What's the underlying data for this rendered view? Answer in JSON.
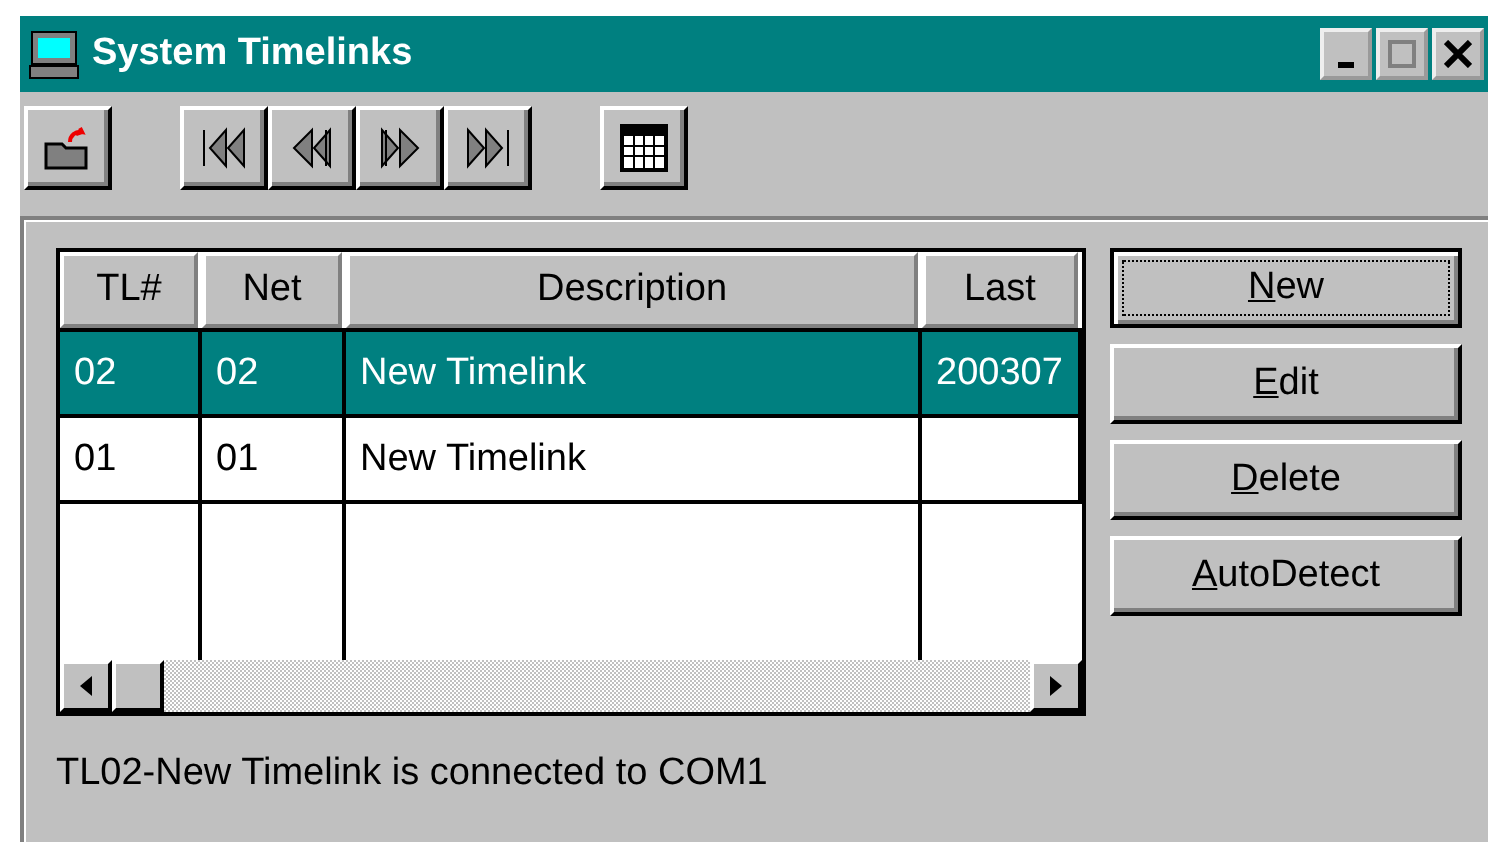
{
  "window": {
    "title": "System Timelinks"
  },
  "toolbar": {
    "groups": [
      {
        "items": [
          {
            "kind": "open"
          }
        ]
      },
      {
        "items": [
          {
            "kind": "first"
          },
          {
            "kind": "prev"
          },
          {
            "kind": "next"
          },
          {
            "kind": "last"
          }
        ]
      },
      {
        "items": [
          {
            "kind": "grid"
          }
        ]
      }
    ]
  },
  "table": {
    "columns": [
      "TL#",
      "Net",
      "Description",
      "Last"
    ],
    "rows": [
      {
        "cells": [
          "02",
          "02",
          "New Timelink",
          "200307"
        ],
        "selected": true
      },
      {
        "cells": [
          "01",
          "01",
          "New Timelink",
          ""
        ],
        "selected": false
      }
    ]
  },
  "buttons": [
    {
      "accel": "N",
      "rest": "ew",
      "focused": true
    },
    {
      "accel": "E",
      "rest": "dit",
      "focused": false
    },
    {
      "accel": "D",
      "rest": "elete",
      "focused": false
    },
    {
      "accel": "A",
      "rest": "utoDetect",
      "focused": false
    }
  ],
  "status": "TL02-New Timelink is connected to COM1"
}
